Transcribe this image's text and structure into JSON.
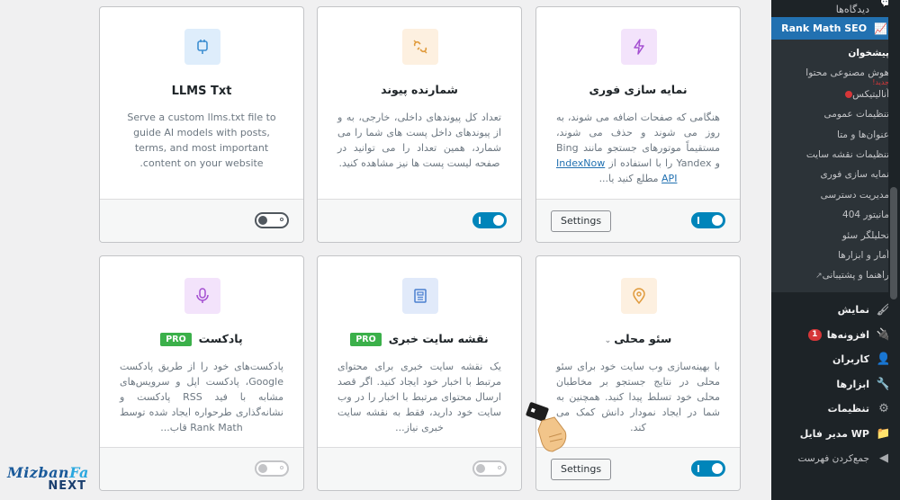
{
  "sidebar": {
    "top_item": "دیدگاه‌ها",
    "active_item": "Rank Math SEO",
    "submenu": [
      {
        "label": "پیشخوان",
        "head": true
      },
      {
        "label": "هوش مصنوعی محتوا",
        "tag": "جدید!"
      },
      {
        "label": "آنالیتیکس",
        "dot": true
      },
      {
        "label": "تنظیمات عمومی"
      },
      {
        "label": "عنوان‌ها و متا"
      },
      {
        "label": "تنظیمات نقشه سایت"
      },
      {
        "label": "نمایه سازی فوری"
      },
      {
        "label": "مدیریت دسترسی"
      },
      {
        "label": "مانیتور 404"
      },
      {
        "label": "تحلیلگر سئو"
      },
      {
        "label": "آمار و ابزارها"
      },
      {
        "label": "راهنما و پشتیبانی",
        "external": true
      }
    ],
    "menu": [
      {
        "label": "نمایش",
        "icon": "brush-icon"
      },
      {
        "label": "افزونه‌ها",
        "icon": "plugin-icon",
        "badge": "1"
      },
      {
        "label": "کاربران",
        "icon": "user-icon"
      },
      {
        "label": "ابزارها",
        "icon": "wrench-icon"
      },
      {
        "label": "تنظیمات",
        "icon": "settings-icon"
      },
      {
        "label": "WP مدیر فایل",
        "icon": "folder-icon"
      },
      {
        "label": "جمع‌کردن فهرست",
        "icon": "collapse-icon",
        "small": true
      }
    ]
  },
  "modules": [
    {
      "title": "LLMS Txt",
      "description": "Serve a custom llms.txt file to guide AI models with posts, terms, and most important content on your website.",
      "icon": "plug-icon",
      "icon_color": "#3f8fd2",
      "icon_bg": "#deedfb",
      "toggle": "off",
      "settings": false
    },
    {
      "title": "شمارنده پیوند",
      "description": "تعداد کل پیوندهای داخلی، خارجی، به و از پیوندهای داخل پست های شما را می شمارد، همین تعداد را می توانید در صفحه لیست پست ها نیز مشاهده کنید.",
      "icon": "broken-link-icon",
      "icon_color": "#e09b3d",
      "icon_bg": "#fdf0e0",
      "toggle": "on",
      "settings": false
    },
    {
      "title": "نمایه سازی فوری",
      "description_pre": "هنگامی که صفحات اضافه می شوند، به روز می شوند و حذف می شوند، مستقیماً موتورهای جستجو مانند Bing و Yandex را با استفاده از ",
      "description_link": "IndexNow API",
      "description_post": " مطلع کنید یا...",
      "icon": "lightning-icon",
      "icon_color": "#a44fd1",
      "icon_bg": "#f3e3fb",
      "toggle": "on",
      "settings": true,
      "settings_label": "Settings"
    },
    {
      "title": "پادکست",
      "pro": "PRO",
      "description": "پادکست‌های خود را از طریق پادکست Google، پادکست اپل و سرویس‌های مشابه با فید RSS پادکست و نشانه‌گذاری طرحواره ایجاد شده توسط Rank Math قاب...",
      "icon": "microphone-icon",
      "icon_color": "#a44fd1",
      "icon_bg": "#f3e3fb",
      "toggle": "disabled",
      "settings": false
    },
    {
      "title": "نقشه سایت خبری",
      "pro": "PRO",
      "description": "یک نقشه سایت خبری برای محتوای مرتبط با اخبار خود ایجاد کنید. اگر قصد ارسال محتوای مرتبط با اخبار را در وب سایت خود دارید، فقط به نقشه سایت خبری نیاز...",
      "icon": "newspaper-icon",
      "icon_color": "#4a7fd0",
      "icon_bg": "#e1eafa",
      "toggle": "disabled",
      "settings": false
    },
    {
      "title": "سئو محلی",
      "description": "با بهینه‌سازی وب سایت خود برای سئو محلی در نتایج جستجو بر مخاطبان محلی خود تسلط پیدا کنید. همچنین به شما در ایجاد نمودار دانش کمک می کند.",
      "icon": "location-pin-icon",
      "icon_color": "#e09b3d",
      "icon_bg": "#fdf0e0",
      "toggle": "on",
      "settings": true,
      "settings_label": "Settings"
    }
  ],
  "watermark": {
    "line1a": "Mizban",
    "line1b": "Fa",
    "line2": "NEXT"
  }
}
